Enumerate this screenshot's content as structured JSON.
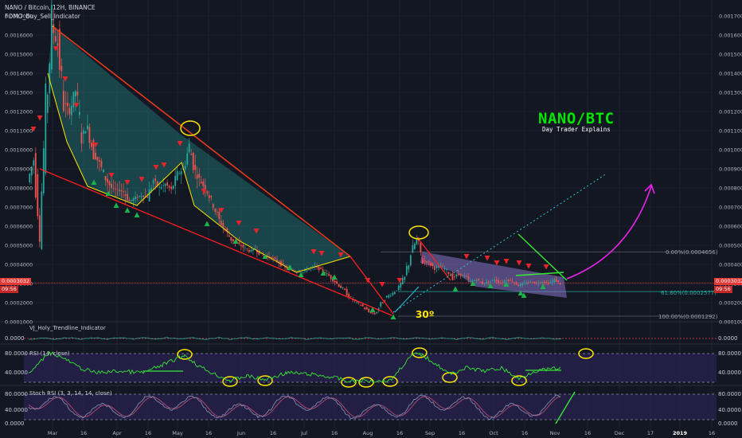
{
  "header": {
    "symbol_line": "NANO / Bitcoin, 12H, BINANCE",
    "indicator": "FOMO_Buy_Sell_Indicator"
  },
  "brand": {
    "title": "NANO/BTC",
    "subtitle": "Day Trader Explains"
  },
  "annotation_angle": "30º",
  "price_tags": {
    "price": "0.0003032",
    "countdown": "09:56"
  },
  "fib_levels": [
    {
      "label": "0.00%(0.0004656)",
      "value": 0.0004656
    },
    {
      "label": "61.80%(0.0002577)",
      "value": 0.0002577
    },
    {
      "label": "100.00%(0.0001292)",
      "value": 0.0001292
    }
  ],
  "panes": {
    "trendline": {
      "title": "VJ_Holy_Trendline_Indicator",
      "tick": "0.0000"
    },
    "rsi": {
      "title": "RSI (14, close)",
      "ticks": [
        "80.0000",
        "40.0000"
      ]
    },
    "stoch": {
      "title": "Stoch RSI (3, 3, 14, 14, close)",
      "ticks": [
        "80.0000",
        "40.0000",
        "0.0000"
      ]
    }
  },
  "colors": {
    "background": "#131722",
    "up_candle": "#26a69a",
    "down_candle": "#ef5350",
    "wedge_fill": "#1f6b6b",
    "yellow_outline": "#ffe500",
    "trend_red": "#ff1f1f",
    "magenta_arrow": "#ee22ee",
    "rsi_line": "#35e835",
    "stoch_k": "#7e8aa8",
    "stoch_d": "#b84b75",
    "pane_band": "#2a2250"
  },
  "chart_data": {
    "type": "line",
    "title": "NANO / Bitcoin, 12H, BINANCE",
    "x_ticks": [
      "Mar",
      "16",
      "Apr",
      "16",
      "May",
      "16",
      "Jun",
      "16",
      "Jul",
      "16",
      "Aug",
      "16",
      "Sep",
      "16",
      "Oct",
      "16",
      "Nov",
      "16",
      "Dec",
      "17",
      "2019",
      "16"
    ],
    "y_ticks": [
      "0.0017000",
      "0.0016000",
      "0.0015000",
      "0.0014000",
      "0.0013000",
      "0.0012000",
      "0.0011000",
      "0.0010000",
      "0.0009000",
      "0.0008000",
      "0.0007000",
      "0.0006000",
      "0.0005000",
      "0.0004000",
      "0.0003000",
      "0.0002000",
      "0.0001000"
    ],
    "ylim": [
      0.0001,
      0.0017
    ],
    "series": [
      {
        "values": [
          0.00083,
          0.00095,
          0.00061,
          0.00118,
          0.00165,
          0.00155,
          0.00125,
          0.0012,
          0.00131,
          0.00108,
          0.00112,
          0.00098,
          0.00093,
          0.00085,
          0.0008,
          0.00079,
          0.00078,
          0.00073,
          0.00075,
          0.00076,
          0.00075,
          0.00084,
          0.0008,
          0.00082,
          0.00079,
          0.00087,
          0.0009,
          0.00102,
          0.00088,
          0.00083,
          0.00078,
          0.00071,
          0.00063,
          0.00058,
          0.00053,
          0.00051,
          0.00049,
          0.00047,
          0.00048,
          0.00045,
          0.00044,
          0.00043,
          0.00041,
          0.00038,
          0.00037,
          0.00036,
          0.00036,
          0.00038,
          0.00039,
          0.00037,
          0.00035,
          0.00032,
          0.00029,
          0.00026,
          0.00022,
          0.0002,
          0.00018,
          0.00015,
          0.00014,
          0.00019,
          0.00023,
          0.00025,
          0.00028,
          0.00033,
          0.00046,
          0.00053,
          0.00042,
          0.00041,
          0.00038,
          0.00039,
          0.00037,
          0.00033,
          0.00035,
          0.00034,
          0.00031,
          0.00032,
          0.0003,
          0.00031,
          0.00032,
          0.0003,
          0.00032,
          0.00031,
          0.00029,
          0.0003,
          0.00031,
          0.0003,
          0.00031,
          0.0003,
          0.00032,
          0.0003
        ]
      }
    ]
  }
}
